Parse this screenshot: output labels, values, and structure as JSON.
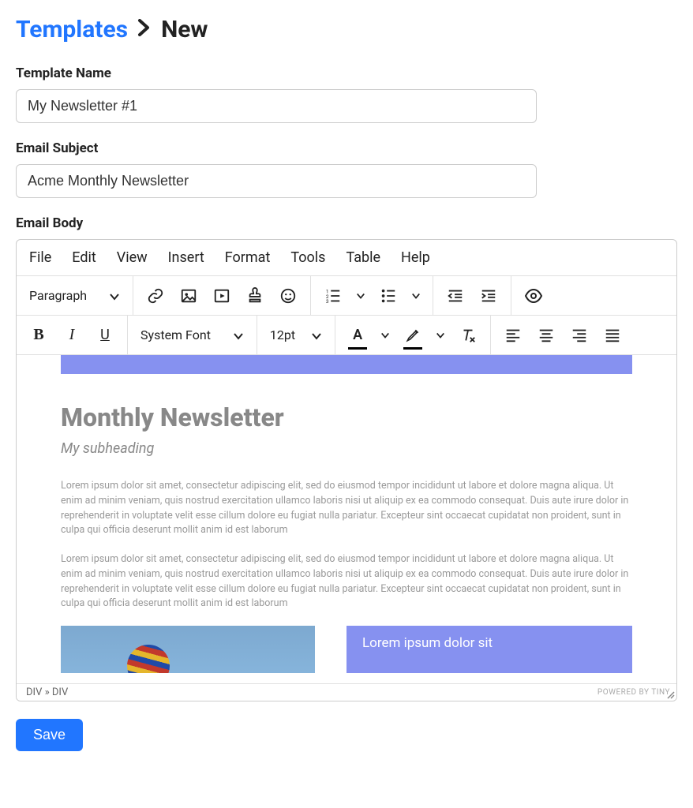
{
  "breadcrumb": {
    "root": "Templates",
    "current": "New"
  },
  "fields": {
    "template_name_label": "Template Name",
    "template_name_value": "My Newsletter #1",
    "email_subject_label": "Email Subject",
    "email_subject_value": "Acme Monthly Newsletter",
    "email_body_label": "Email Body"
  },
  "editor": {
    "menubar": [
      "File",
      "Edit",
      "View",
      "Insert",
      "Format",
      "Tools",
      "Table",
      "Help"
    ],
    "block_format": "Paragraph",
    "font_family": "System Font",
    "font_size": "12pt",
    "statusbar_path": "DIV » DIV",
    "branding": "POWERED BY TINY"
  },
  "content": {
    "title": "Monthly Newsletter",
    "subheading": "My subheading",
    "para1": "Lorem ipsum dolor sit amet, consectetur adipiscing elit, sed do eiusmod tempor incididunt ut labore et dolore magna aliqua. Ut enim ad minim veniam, quis nostrud exercitation ullamco laboris nisi ut aliquip ex ea commodo consequat. Duis aute irure dolor in reprehenderit in voluptate velit esse cillum dolore eu fugiat nulla pariatur. Excepteur sint occaecat cupidatat non proident, sunt in culpa qui officia deserunt mollit anim id est laborum",
    "para2": "Lorem ipsum dolor sit amet, consectetur adipiscing elit, sed do eiusmod tempor incididunt ut labore et dolore magna aliqua. Ut enim ad minim veniam, quis nostrud exercitation ullamco laboris nisi ut aliquip ex ea commodo consequat. Duis aute irure dolor in reprehenderit in voluptate velit esse cillum dolore eu fugiat nulla pariatur. Excepteur sint occaecat cupidatat non proident, sunt in culpa qui officia deserunt mollit anim id est laborum",
    "callout": "Lorem ipsum dolor sit"
  },
  "buttons": {
    "save": "Save"
  }
}
